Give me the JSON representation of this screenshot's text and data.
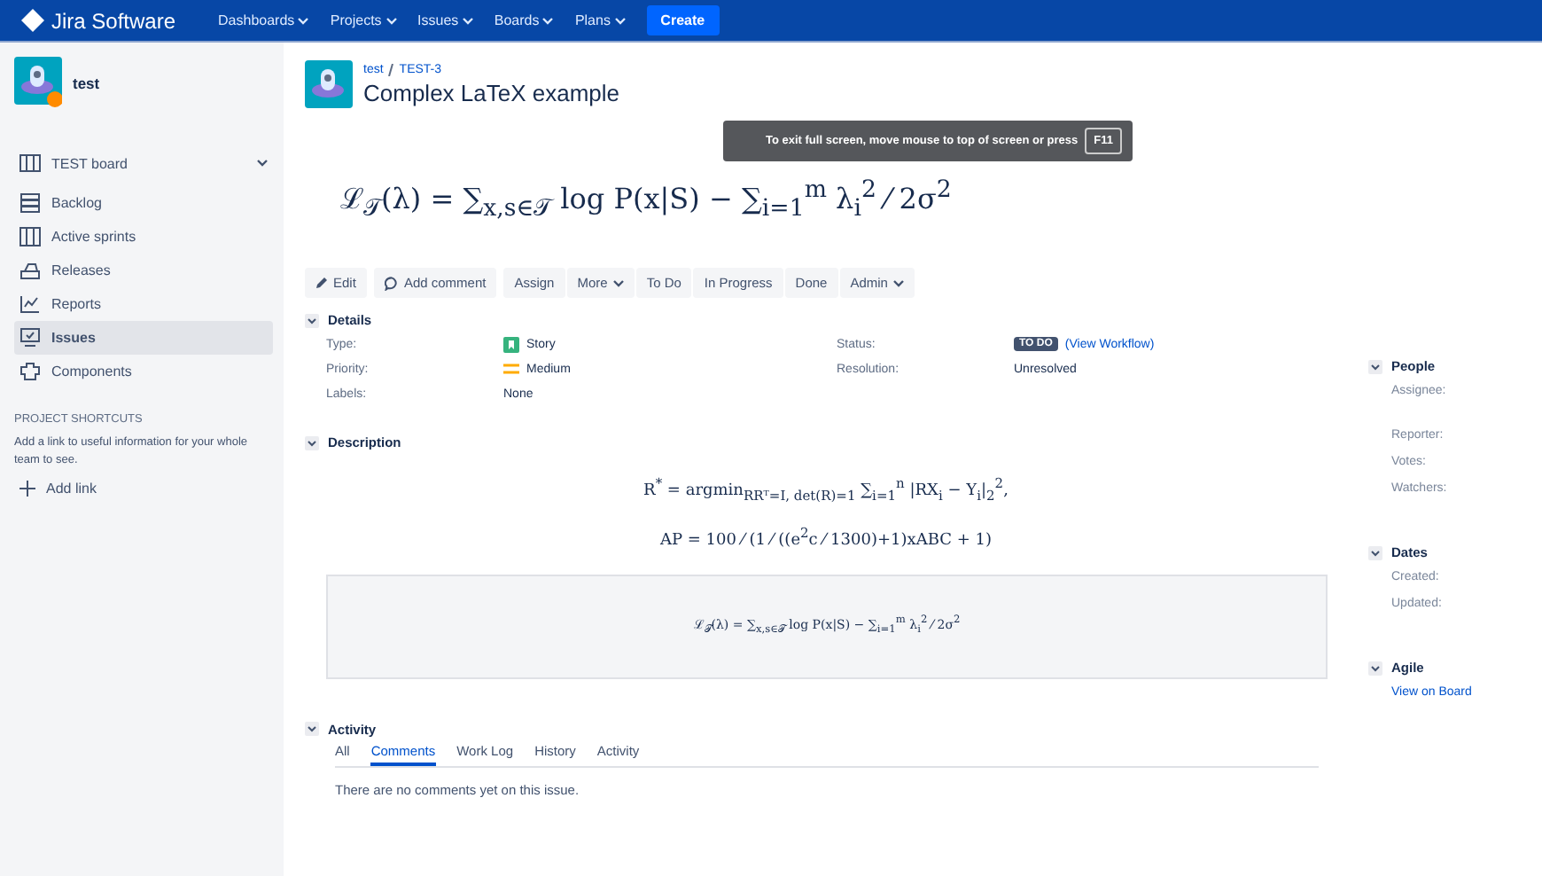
{
  "topnav": {
    "logo": "Jira Software",
    "menus": [
      {
        "label": "Dashboards"
      },
      {
        "label": "Projects"
      },
      {
        "label": "Issues"
      },
      {
        "label": "Boards"
      },
      {
        "label": "Plans"
      }
    ],
    "create": "Create"
  },
  "sidebar": {
    "project": "test",
    "board": "TEST board",
    "items": [
      {
        "label": "Backlog",
        "selected": false
      },
      {
        "label": "Active sprints",
        "selected": false
      },
      {
        "label": "Releases",
        "selected": false
      },
      {
        "label": "Reports",
        "selected": false
      },
      {
        "label": "Issues",
        "selected": true
      },
      {
        "label": "Components",
        "selected": false
      }
    ],
    "shortcuts_heading": "PROJECT SHORTCUTS",
    "shortcuts_text": "Add a link to useful information for your whole team to see.",
    "add_link": "Add link"
  },
  "issue": {
    "breadcrumb": [
      "test",
      "TEST-3"
    ],
    "title": "Complex LaTeX example",
    "formula": "ℒ$_{𝒯}$(λ) = ∑$_{x,s∈𝒯}$ log P(x|S) − ∑$_{i=1}$$^{m}$ λ$_{i}$$^{2}$ ⁄ 2σ$^{2}$"
  },
  "toast": {
    "text": "To exit full screen, move mouse to top of screen or press",
    "key": "F11"
  },
  "toolbar": [
    {
      "label": "Edit",
      "kind": "edit"
    },
    {
      "label": "Add comment",
      "kind": "comment"
    },
    {
      "label": "Assign",
      "kind": "plain"
    },
    {
      "label": "More",
      "kind": "menu"
    },
    {
      "label": "To Do",
      "kind": "plain"
    },
    {
      "label": "In Progress",
      "kind": "plain"
    },
    {
      "label": "Done",
      "kind": "plain"
    },
    {
      "label": "Admin",
      "kind": "menu"
    }
  ],
  "details": {
    "heading": "Details",
    "left": [
      {
        "label": "Type:",
        "value": "Story",
        "kind": "story"
      },
      {
        "label": "Priority:",
        "value": "Medium",
        "kind": "priority"
      },
      {
        "label": "Labels:",
        "value": "None",
        "kind": "plain"
      }
    ],
    "status_label": "Status:",
    "status": "TO DO",
    "workflow": "(View Workflow)",
    "resolution_label": "Resolution:",
    "resolution": "Unresolved"
  },
  "description": {
    "heading": "Description",
    "formulas": [
      "R$^{*}$ = argmin$_{RRᵀ=I, det(R)=1}$ ∑$_{i=1}$$^{n}$ |RX$_{i}$ − Y$_{i}$|$_{2}$$^{2}$,",
      "AP = 100 ⁄ (1 ⁄ ((e$^{2}$c ⁄ 1300)+1)xABC + 1)"
    ],
    "code_formula": "ℒ$_{𝒯}$(λ) = ∑$_{x,s∈𝒯}$ log P(x|S) − ∑$_{i=1}$$^{m}$ λ$_{i}$$^{2}$ ⁄ 2σ$^{2}$"
  },
  "activity": {
    "heading": "Activity",
    "tabs": [
      {
        "label": "All",
        "selected": false
      },
      {
        "label": "Comments",
        "selected": true
      },
      {
        "label": "Work Log",
        "selected": false
      },
      {
        "label": "History",
        "selected": false
      },
      {
        "label": "Activity",
        "selected": false
      }
    ],
    "empty": "There are no comments yet on this issue."
  },
  "right": [
    {
      "heading": "People",
      "rows": [
        {
          "text": "Assignee:",
          "kind": "label"
        },
        {
          "text": "Reporter:",
          "kind": "label"
        },
        {
          "text": "Votes:",
          "kind": "label"
        },
        {
          "text": "Watchers:",
          "kind": "label"
        }
      ]
    },
    {
      "heading": "Dates",
      "rows": [
        {
          "text": "Created:",
          "kind": "label"
        },
        {
          "text": "Updated:",
          "kind": "label"
        }
      ]
    },
    {
      "heading": "Agile",
      "rows": [
        {
          "text": "View on Board",
          "kind": "link"
        }
      ]
    }
  ]
}
